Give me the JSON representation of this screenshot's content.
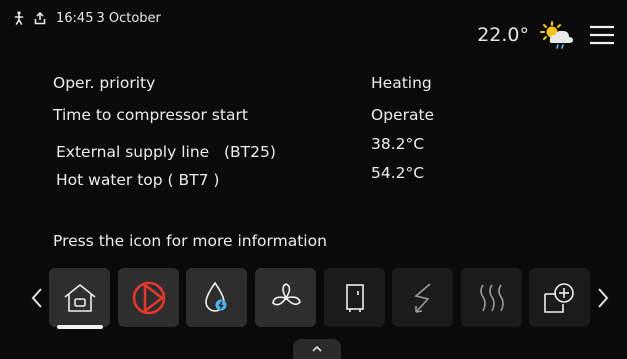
{
  "status": {
    "time": "16:45",
    "date": "3 October"
  },
  "header": {
    "outdoor_temp": "22.0°"
  },
  "info_rows": [
    {
      "label": "Oper. priority",
      "value": "Heating"
    },
    {
      "label": "Time to compressor start",
      "value": "Operate"
    },
    {
      "label": "External supply line   (BT25)",
      "value": "38.2°C"
    },
    {
      "label": "Hot water top ( BT7 )",
      "value": "54.2°C"
    }
  ],
  "hint": "Press the icon for more information",
  "icons": {
    "status": [
      "person-icon",
      "upload-icon"
    ],
    "header": [
      "partly-sunny-rain-icon",
      "hamburger-menu-icon"
    ],
    "tiles": [
      "home-icon",
      "compressor-icon",
      "hot-water-icon",
      "fan-icon",
      "tank-icon",
      "electric-heater-icon",
      "heating-icon",
      "add-accessory-icon"
    ],
    "nav": [
      "chevron-left-icon",
      "chevron-right-icon",
      "chevron-up-icon"
    ]
  },
  "colors": {
    "background": "#0a0a0a",
    "tile": "#2e2e2e",
    "compressor_red": "#e5382c",
    "sun": "#f4c41c"
  }
}
